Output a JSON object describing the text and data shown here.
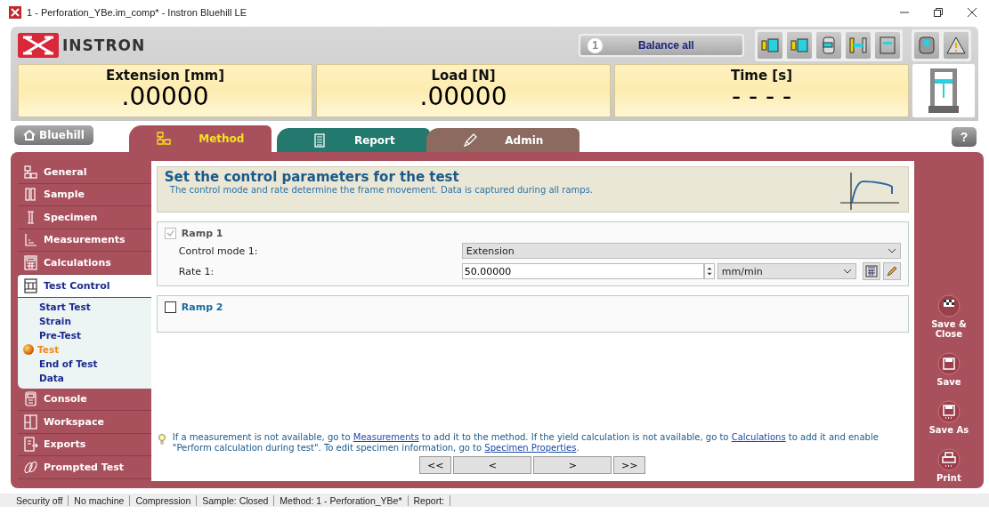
{
  "window": {
    "title": "1 - Perforation_YBe.im_comp* - Instron Bluehill LE"
  },
  "header": {
    "logo": "INSTRON",
    "balance": {
      "number": "1",
      "label": "Balance all"
    }
  },
  "readouts": [
    {
      "label": "Extension [mm]",
      "value": ".00000"
    },
    {
      "label": "Load [N]",
      "value": ".00000"
    },
    {
      "label": "Time [s]",
      "value": "- - - -"
    }
  ],
  "home_button": "Bluehill",
  "tabs": [
    {
      "label": "Method",
      "selected": true,
      "color": "#a9505d"
    },
    {
      "label": "Report",
      "selected": false,
      "color": "#23796e"
    },
    {
      "label": "Admin",
      "selected": false,
      "color": "#8c6a60"
    }
  ],
  "help_button": "?",
  "sidebar": {
    "items": [
      {
        "label": "General",
        "selected": false
      },
      {
        "label": "Sample",
        "selected": false
      },
      {
        "label": "Specimen",
        "selected": false
      },
      {
        "label": "Measurements",
        "selected": false
      },
      {
        "label": "Calculations",
        "selected": false
      },
      {
        "label": "Test Control",
        "selected": true,
        "children": [
          {
            "label": "Start Test",
            "selected": false
          },
          {
            "label": "Strain",
            "selected": false
          },
          {
            "label": "Pre-Test",
            "selected": false
          },
          {
            "label": "Test",
            "selected": true
          },
          {
            "label": "End of Test",
            "selected": false
          },
          {
            "label": "Data",
            "selected": false
          }
        ]
      },
      {
        "label": "Console",
        "selected": false
      },
      {
        "label": "Workspace",
        "selected": false
      },
      {
        "label": "Exports",
        "selected": false
      },
      {
        "label": "Prompted Test",
        "selected": false
      }
    ]
  },
  "panel": {
    "title": "Set the control parameters for the test",
    "subtitle": "The control mode and rate determine the frame movement. Data is captured during all ramps."
  },
  "ramps": [
    {
      "label": "Ramp 1",
      "checked": true,
      "disabled": true,
      "fields": [
        {
          "kind": "select",
          "label": "Control mode 1:",
          "value": "Extension"
        },
        {
          "kind": "rate",
          "label": "Rate 1:",
          "value": "50.00000",
          "unit": "mm/min"
        }
      ]
    },
    {
      "label": "Ramp 2",
      "checked": false,
      "disabled": false
    }
  ],
  "hint": [
    {
      "text": "If a measurement is not available, go to ",
      "link": false
    },
    {
      "text": "Measurements",
      "link": true
    },
    {
      "text": " to add it to the method. If the yield calculation is not available, go to ",
      "link": false
    },
    {
      "text": "Calculations",
      "link": true
    },
    {
      "text": " to add it and enable \"Perform calculation during test\". To edit specimen information, go to ",
      "link": false
    },
    {
      "text": "Specimen Properties",
      "link": true
    },
    {
      "text": ".",
      "link": false
    }
  ],
  "nav_buttons": [
    "<<",
    "<",
    ">",
    ">>"
  ],
  "actions": [
    {
      "label": "Save & Close",
      "kind": "flag"
    },
    {
      "label": "Save",
      "kind": "save"
    },
    {
      "label": "Save As",
      "kind": "saveas"
    },
    {
      "label": "Print",
      "kind": "print"
    }
  ],
  "status_bar": [
    "Security off",
    "No machine",
    "Compression",
    "Sample: Closed",
    "Method: 1 - Perforation_YBe*",
    "Report:"
  ]
}
